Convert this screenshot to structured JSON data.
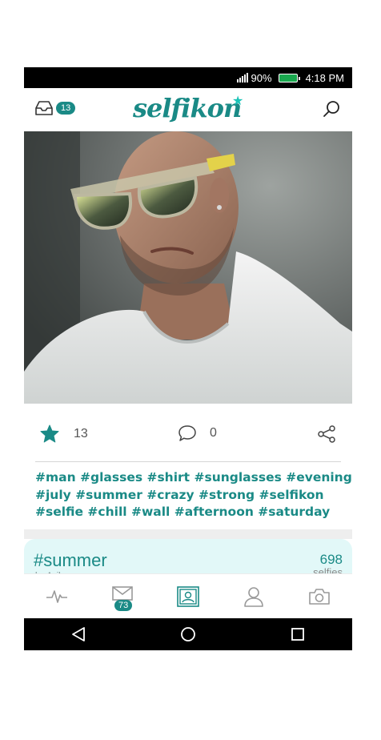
{
  "status_bar": {
    "battery": "90%",
    "time": "4:18 PM"
  },
  "header": {
    "app_name": "selfikon",
    "inbox_count": "13"
  },
  "post": {
    "likes": "13",
    "comments": "0",
    "tags": [
      "#man #glasses #shirt #sunglasses #evening",
      "#july #summer #crazy #strong #selfikon",
      "#selfie #chill #wall #afternoon #saturday"
    ]
  },
  "collection_card": {
    "title": "#summer",
    "subtitle": "by Avik",
    "count": "698",
    "unit": "selfies"
  },
  "bottom_nav": {
    "messages_badge": "73",
    "active": "profile"
  },
  "colors": {
    "accent": "#1a8a86",
    "card_bg": "#e2f8f8",
    "star": "#1bc3b7"
  },
  "icons": [
    "inbox-icon",
    "search-icon",
    "star-icon",
    "comment-icon",
    "share-icon",
    "activity-icon",
    "mail-icon",
    "profile-card-icon",
    "person-icon",
    "camera-icon",
    "back-icon",
    "home-icon",
    "recents-icon"
  ]
}
